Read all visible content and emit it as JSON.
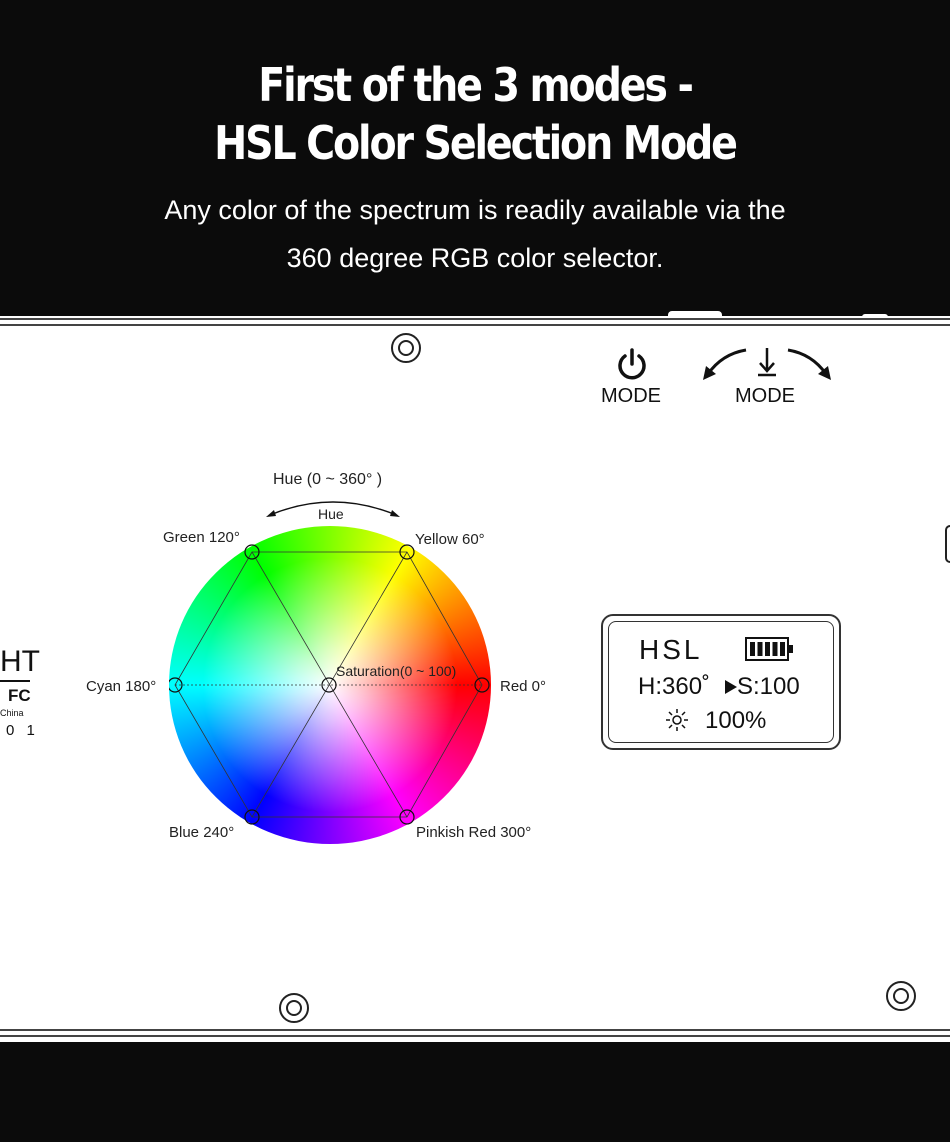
{
  "header": {
    "title_line1": "First of the 3 modes -",
    "title_line2": "HSL Color Selection Mode",
    "subtitle_line1": "Any color of the spectrum is readily available via the",
    "subtitle_line2": "360 degree RGB color selector."
  },
  "buttons": {
    "power_mode_label": "MODE",
    "adjust_mode_label": "MODE"
  },
  "wheel": {
    "hue_range_label": "Hue (0 ~ 360° )",
    "hue_label": "Hue",
    "saturation_label": "Saturation(0 ~ 100)",
    "green_label": "Green 120°",
    "yellow_label": "Yellow 60°",
    "cyan_label": "Cyan 180°",
    "red_label": "Red 0°",
    "blue_label": "Blue 240°",
    "pink_label": "Pinkish Red 300°"
  },
  "display": {
    "mode": "HSL",
    "hue_text": "H:360˚",
    "sat_text": "S:100",
    "brightness_text": "100%",
    "battery_level": 1.0
  },
  "left_edge": {
    "text_top": "HT",
    "text_fc": "FC",
    "text_china": "China",
    "text_num": "0 1"
  },
  "colors": {
    "background": "#0b0b0b",
    "panel": "#ffffff"
  }
}
